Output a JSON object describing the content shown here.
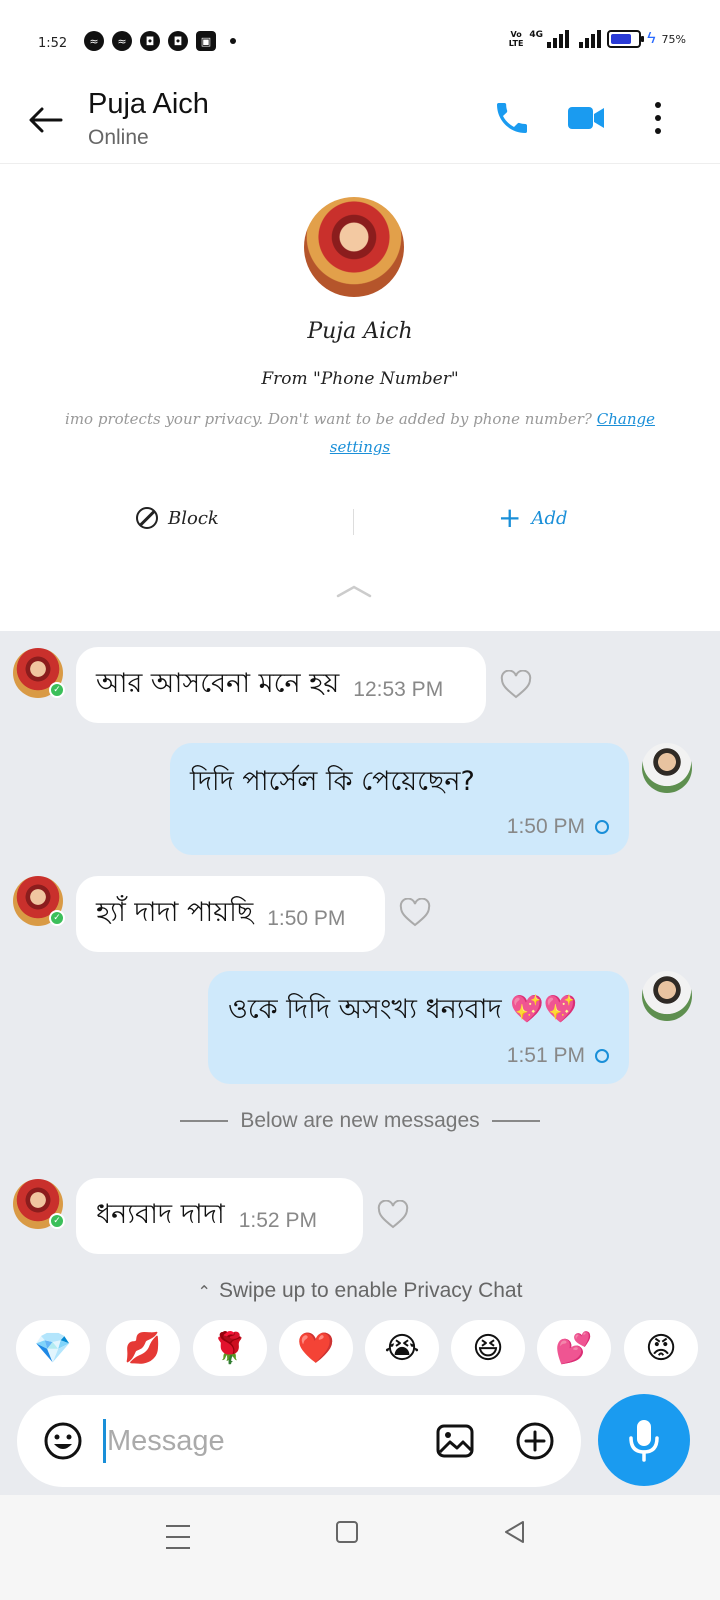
{
  "status_bar": {
    "time": "1:52",
    "network_label": "4G",
    "volte_label": "Vo\nLTE",
    "battery_percent_label": "75%",
    "battery_level": 0.75,
    "notification_icons": [
      "messenger-icon",
      "messenger-icon",
      "app-icon",
      "app-icon",
      "app-icon"
    ]
  },
  "header": {
    "contact_name": "Puja Aich",
    "contact_status": "Online"
  },
  "profile": {
    "name": "Puja Aich",
    "from_text": "From \"Phone Number\"",
    "privacy_text": "imo protects your privacy. Don't want to be added by phone number? ",
    "privacy_link": "Change settings",
    "block_label": "Block",
    "add_label": "Add"
  },
  "messages": [
    {
      "direction": "in",
      "text": "আর আসবেনা মনে হয়",
      "time": "12:53 PM"
    },
    {
      "direction": "out",
      "text": "দিদি পার্সেল কি পেয়েছেন?",
      "time": "1:50 PM"
    },
    {
      "direction": "in",
      "text": "হ্যাঁ দাদা পায়ছি",
      "time": "1:50 PM"
    },
    {
      "direction": "out",
      "text": "ওকে দিদি অসংখ্য ধন্যবাদ 💖💖",
      "time": "1:51 PM"
    },
    {
      "direction": "in",
      "text": "ধন্যবাদ দাদা",
      "time": "1:52 PM"
    }
  ],
  "new_messages_separator": "Below are new messages",
  "privacy_chat_hint": "Swipe up to enable Privacy Chat",
  "quick_reactions": [
    "💎",
    "💋",
    "🌹",
    "❤️",
    "😭",
    "😆",
    "💕",
    "😡"
  ],
  "composer": {
    "placeholder": "Message"
  },
  "colors": {
    "accent": "#1a9bf0",
    "outgoing_bubble": "#cfe9fb",
    "chat_background": "#e9ebef",
    "online_badge": "#3bbf5a"
  }
}
